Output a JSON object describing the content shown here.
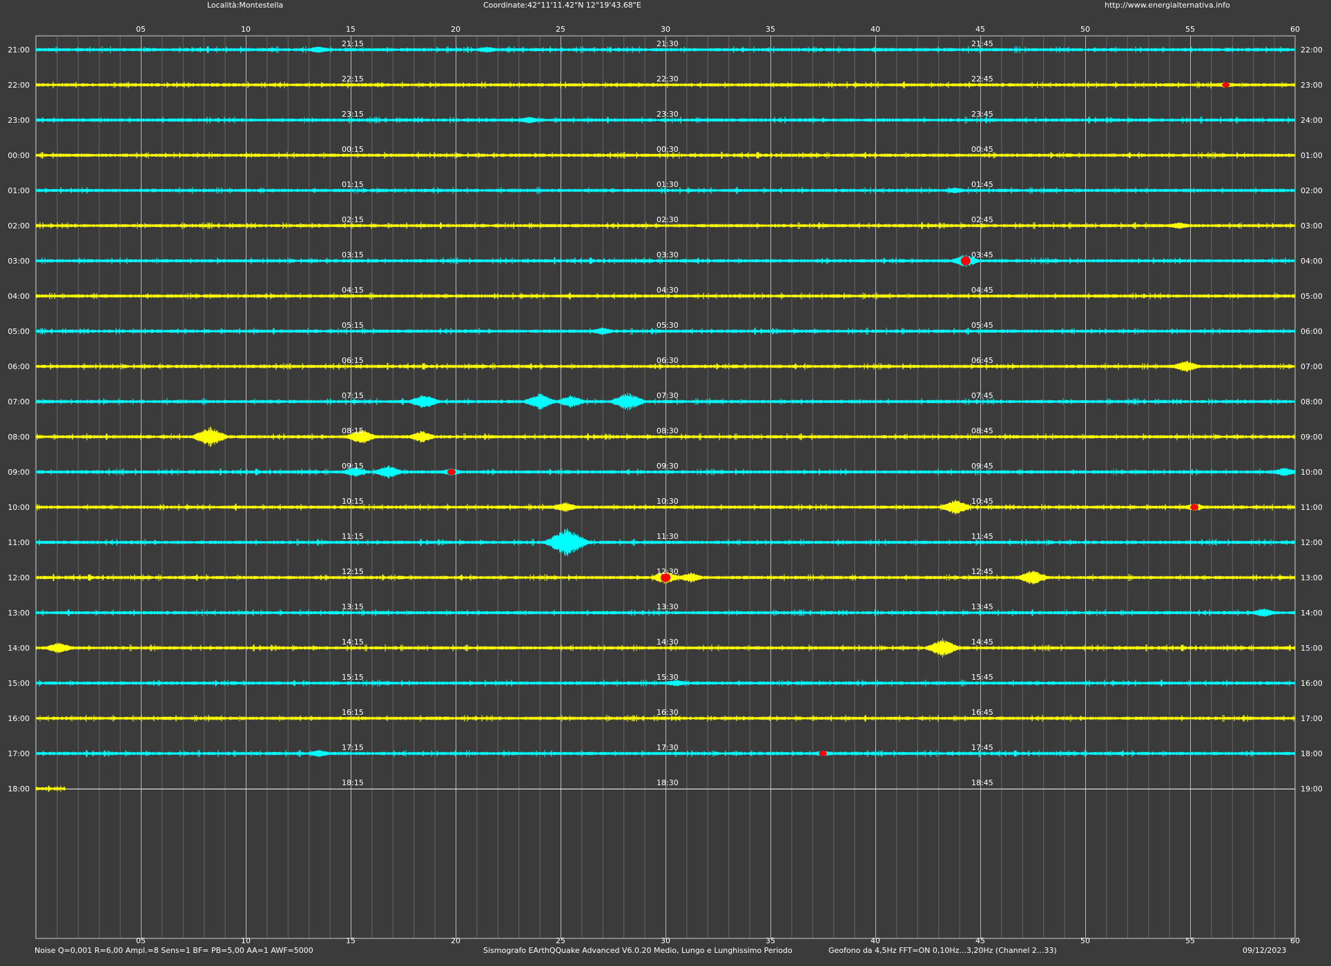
{
  "header": {
    "location": "Località:Montestella",
    "coordinates": "Coordinate:42°11'11.42\"N  12°19'43.68\"E",
    "url": "http://www.energialternativa.info"
  },
  "footer": {
    "settings": "Noise Q=0,001 R=6,00 Ampl.=8 Sens=1 BF= PB=5,00 AA=1 AWF=5000",
    "software": "Sismografo  EArthQQuake Advanced V6.0.20  Medio, Lungo e Lunghissimo Periodo",
    "sensor": "Geofono da 4,5Hz FFT=ON 0,10Hz...3,20Hz      (Channel 2...33)",
    "date": "09/12/2023"
  },
  "chart_data": {
    "type": "line",
    "title": "",
    "x_ticks": [
      "05",
      "10",
      "15",
      "20",
      "25",
      "30",
      "35",
      "40",
      "45",
      "50",
      "55",
      "60"
    ],
    "xlim": [
      0,
      60
    ],
    "x_unit": "minutes",
    "colors": {
      "background": "#3b3b3b",
      "grid": "#cfcfcf",
      "grid_minor": "#9a9a9a",
      "trace_even": "#00ffff",
      "trace_odd": "#ffff00",
      "event_marker": "#ff0000",
      "text": "#ffffff"
    },
    "rows": [
      {
        "left": "21:00",
        "right": "22:00",
        "m15": "21:15",
        "m30": "21:30",
        "m45": "21:45",
        "color": "cyan"
      },
      {
        "left": "22:00",
        "right": "23:00",
        "m15": "22:15",
        "m30": "22:30",
        "m45": "22:45",
        "color": "yellow"
      },
      {
        "left": "23:00",
        "right": "24:00",
        "m15": "23:15",
        "m30": "23:30",
        "m45": "23:45",
        "color": "cyan"
      },
      {
        "left": "00:00",
        "right": "01:00",
        "m15": "00:15",
        "m30": "00:30",
        "m45": "00:45",
        "color": "yellow"
      },
      {
        "left": "01:00",
        "right": "02:00",
        "m15": "01:15",
        "m30": "01:30",
        "m45": "01:45",
        "color": "cyan"
      },
      {
        "left": "02:00",
        "right": "03:00",
        "m15": "02:15",
        "m30": "02:30",
        "m45": "02:45",
        "color": "yellow"
      },
      {
        "left": "03:00",
        "right": "04:00",
        "m15": "03:15",
        "m30": "03:30",
        "m45": "03:45",
        "color": "cyan"
      },
      {
        "left": "04:00",
        "right": "05:00",
        "m15": "04:15",
        "m30": "04:30",
        "m45": "04:45",
        "color": "yellow"
      },
      {
        "left": "05:00",
        "right": "06:00",
        "m15": "05:15",
        "m30": "05:30",
        "m45": "05:45",
        "color": "cyan"
      },
      {
        "left": "06:00",
        "right": "07:00",
        "m15": "06:15",
        "m30": "06:30",
        "m45": "06:45",
        "color": "yellow"
      },
      {
        "left": "07:00",
        "right": "08:00",
        "m15": "07:15",
        "m30": "07:30",
        "m45": "07:45",
        "color": "cyan"
      },
      {
        "left": "08:00",
        "right": "09:00",
        "m15": "08:15",
        "m30": "08:30",
        "m45": "08:45",
        "color": "yellow"
      },
      {
        "left": "09:00",
        "right": "10:00",
        "m15": "09:15",
        "m30": "09:30",
        "m45": "09:45",
        "color": "cyan"
      },
      {
        "left": "10:00",
        "right": "11:00",
        "m15": "10:15",
        "m30": "10:30",
        "m45": "10:45",
        "color": "yellow"
      },
      {
        "left": "11:00",
        "right": "12:00",
        "m15": "11:15",
        "m30": "11:30",
        "m45": "11:45",
        "color": "cyan"
      },
      {
        "left": "12:00",
        "right": "13:00",
        "m15": "12:15",
        "m30": "12:30",
        "m45": "12:45",
        "color": "yellow"
      },
      {
        "left": "13:00",
        "right": "14:00",
        "m15": "13:15",
        "m30": "13:30",
        "m45": "13:45",
        "color": "cyan"
      },
      {
        "left": "14:00",
        "right": "15:00",
        "m15": "14:15",
        "m30": "14:30",
        "m45": "14:45",
        "color": "yellow"
      },
      {
        "left": "15:00",
        "right": "16:00",
        "m15": "15:15",
        "m30": "15:30",
        "m45": "15:45",
        "color": "cyan"
      },
      {
        "left": "16:00",
        "right": "17:00",
        "m15": "16:15",
        "m30": "16:30",
        "m45": "16:45",
        "color": "yellow"
      },
      {
        "left": "17:00",
        "right": "18:00",
        "m15": "17:15",
        "m30": "17:30",
        "m45": "17:45",
        "color": "cyan"
      },
      {
        "left": "18:00",
        "right": "19:00",
        "m15": "18:15",
        "m30": "18:30",
        "m45": "18:45",
        "color": "yellow",
        "partial_until_minute": 1.4
      }
    ],
    "events": [
      {
        "row": 0,
        "minute": 13.5,
        "amplitude": 0.25
      },
      {
        "row": 0,
        "minute": 21.5,
        "amplitude": 0.2
      },
      {
        "row": 1,
        "minute": 56.7,
        "amplitude": 0.15,
        "marker": true
      },
      {
        "row": 2,
        "minute": 23.5,
        "amplitude": 0.25
      },
      {
        "row": 4,
        "minute": 43.8,
        "amplitude": 0.2
      },
      {
        "row": 5,
        "minute": 54.5,
        "amplitude": 0.25
      },
      {
        "row": 6,
        "minute": 44.3,
        "amplitude": 0.7,
        "marker": true
      },
      {
        "row": 8,
        "minute": 27,
        "amplitude": 0.3
      },
      {
        "row": 9,
        "minute": 54.8,
        "amplitude": 0.6
      },
      {
        "row": 10,
        "minute": 18.5,
        "amplitude": 0.8
      },
      {
        "row": 10,
        "minute": 24,
        "amplitude": 0.9
      },
      {
        "row": 10,
        "minute": 25.5,
        "amplitude": 0.7
      },
      {
        "row": 10,
        "minute": 28.2,
        "amplitude": 1.0
      },
      {
        "row": 11,
        "minute": 8.3,
        "amplitude": 1.1
      },
      {
        "row": 11,
        "minute": 15.5,
        "amplitude": 0.8
      },
      {
        "row": 11,
        "minute": 18.4,
        "amplitude": 0.6
      },
      {
        "row": 12,
        "minute": 15.2,
        "amplitude": 0.5
      },
      {
        "row": 12,
        "minute": 16.8,
        "amplitude": 0.7
      },
      {
        "row": 12,
        "minute": 19.8,
        "amplitude": 0.3,
        "marker": true
      },
      {
        "row": 12,
        "minute": 59.5,
        "amplitude": 0.4
      },
      {
        "row": 13,
        "minute": 25.2,
        "amplitude": 0.5
      },
      {
        "row": 13,
        "minute": 43.8,
        "amplitude": 0.8
      },
      {
        "row": 13,
        "minute": 55.2,
        "amplitude": 0.3,
        "marker": true
      },
      {
        "row": 14,
        "minute": 25.3,
        "amplitude": 1.6
      },
      {
        "row": 15,
        "minute": 30,
        "amplitude": 0.7,
        "marker": true
      },
      {
        "row": 15,
        "minute": 31.2,
        "amplitude": 0.5
      },
      {
        "row": 15,
        "minute": 47.5,
        "amplitude": 0.8
      },
      {
        "row": 16,
        "minute": 58.5,
        "amplitude": 0.4
      },
      {
        "row": 17,
        "minute": 1.1,
        "amplitude": 0.6
      },
      {
        "row": 17,
        "minute": 43.2,
        "amplitude": 1.0
      },
      {
        "row": 18,
        "minute": 30.5,
        "amplitude": 0.25
      },
      {
        "row": 20,
        "minute": 13.5,
        "amplitude": 0.3
      },
      {
        "row": 20,
        "minute": 37.5,
        "amplitude": 0.2,
        "marker": true
      }
    ]
  }
}
